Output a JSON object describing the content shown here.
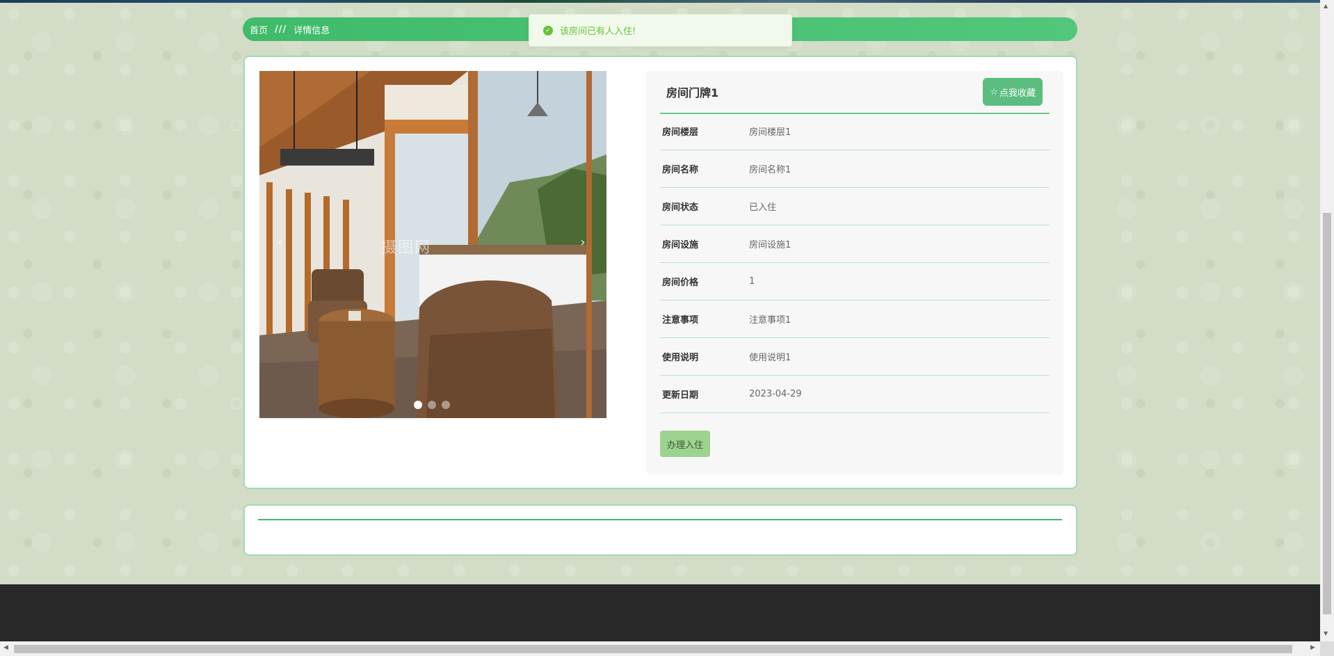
{
  "breadcrumb": {
    "home": "首页",
    "separator": "///",
    "current": "详情信息"
  },
  "toast": {
    "icon": "check-circle-icon",
    "message": "该房间已有人入住!"
  },
  "carousel": {
    "watermark": "摄图网",
    "prev_icon": "‹",
    "next_icon": "›",
    "active_index": 0,
    "slide_count": 3
  },
  "details": {
    "title": "房间门牌1",
    "favorite_label": "点我收藏",
    "favorite_icon": "☆",
    "fields": [
      {
        "label": "房间楼层",
        "value": "房间楼层1"
      },
      {
        "label": "房间名称",
        "value": "房间名称1"
      },
      {
        "label": "房间状态",
        "value": "已入住"
      },
      {
        "label": "房间设施",
        "value": "房间设施1"
      },
      {
        "label": "房间价格",
        "value": "1"
      },
      {
        "label": "注意事项",
        "value": "注意事项1"
      },
      {
        "label": "使用说明",
        "value": "使用说明1"
      },
      {
        "label": "更新日期",
        "value": "2023-04-29"
      }
    ],
    "checkin_label": "办理入住"
  },
  "colors": {
    "accent": "#3fbb6a",
    "toast_bg": "#f0f9eb",
    "toast_text": "#67c23a",
    "footer": "#282828"
  }
}
